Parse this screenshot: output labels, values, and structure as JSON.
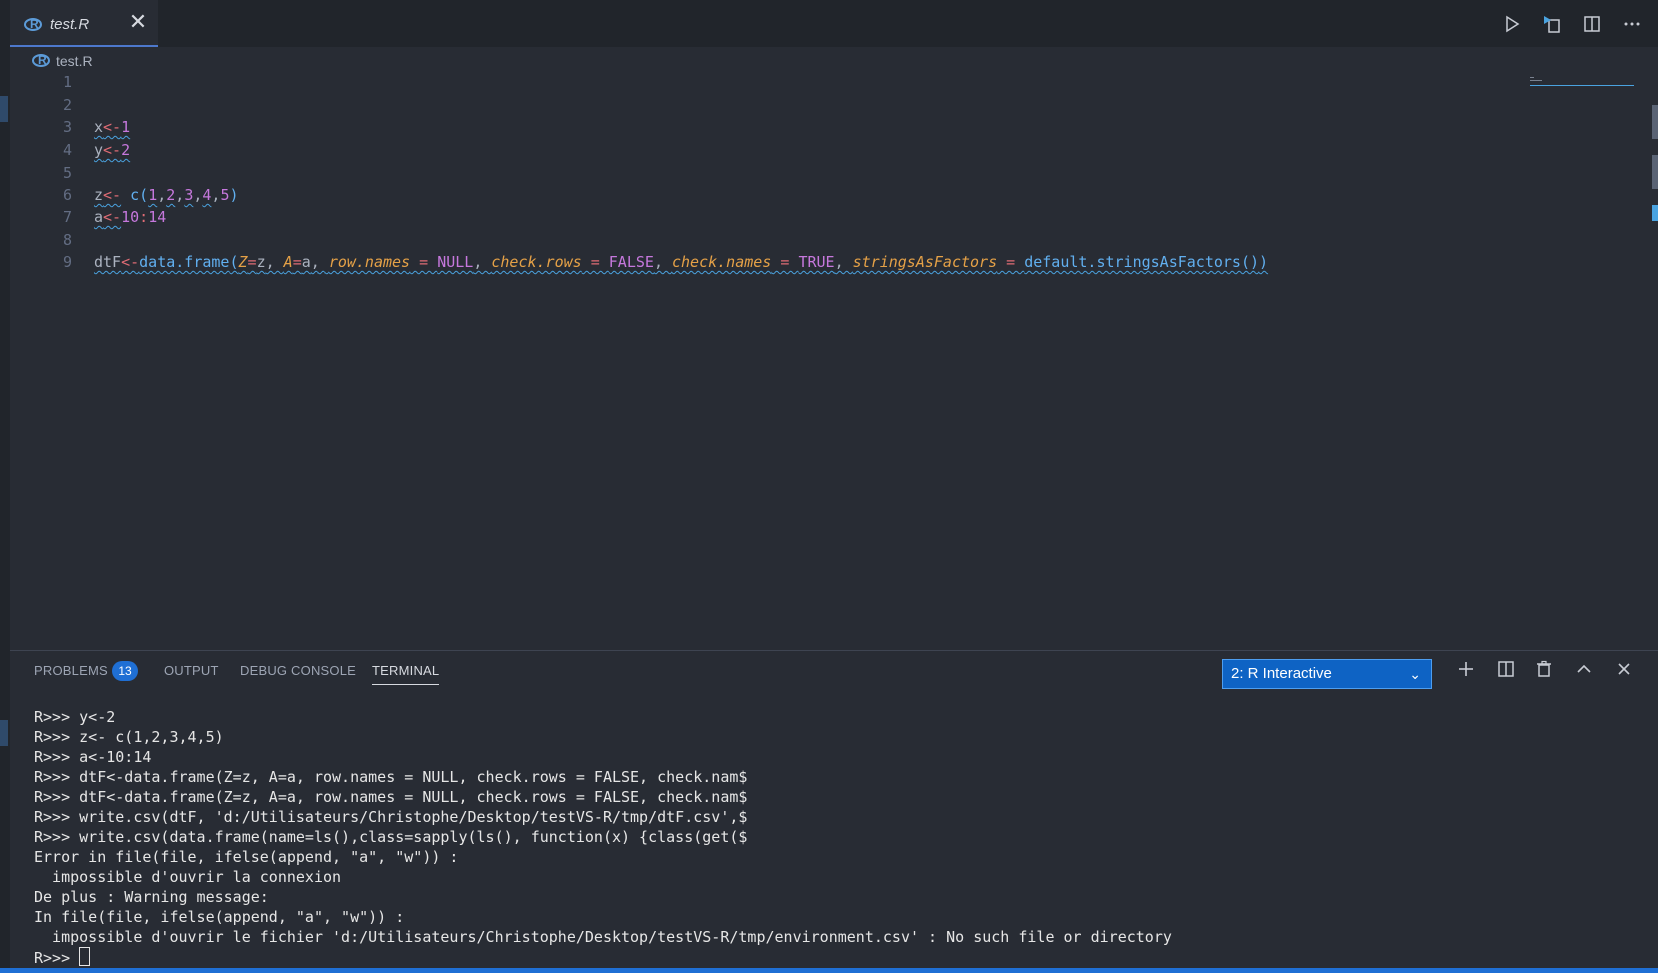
{
  "tab": {
    "title": "test.R",
    "close": "✕"
  },
  "breadcrumb": {
    "file": "test.R"
  },
  "editor": {
    "line_numbers": [
      "1",
      "2",
      "3",
      "4",
      "5",
      "6",
      "7",
      "8",
      "9"
    ],
    "line3": {
      "v": "x",
      "op": "<-",
      "val": "1"
    },
    "line4": {
      "v": "y",
      "op": "<-",
      "val": "2"
    },
    "line6": {
      "v": "z",
      "op": "<-",
      "fn": "c",
      "open": "(",
      "n1": "1",
      "n2": "2",
      "n3": "3",
      "n4": "4",
      "n5": "5",
      "close": ")"
    },
    "line7": {
      "v": "a",
      "op": "<-",
      "from": "10",
      "colon": ":",
      "to": "14"
    },
    "line9": {
      "v": "dtF",
      "op": "<-",
      "fn": "data.frame",
      "open": "(",
      "a1": "Z",
      "eq1": "=",
      "v1": "z",
      "a2": "A",
      "eq2": "=",
      "v2": "a",
      "a3": "row.names",
      "eq3": " = ",
      "v3": "NULL",
      "a4": "check.rows",
      "eq4": " = ",
      "v4": "FALSE",
      "a5": "check.names",
      "eq5": " = ",
      "v5": "TRUE",
      "a6": "stringsAsFactors",
      "eq6": " = ",
      "v6": "default.stringsAsFactors",
      "inner": "()",
      "close": ")"
    }
  },
  "panel": {
    "tabs": [
      {
        "label": "PROBLEMS",
        "badge": "13"
      },
      {
        "label": "OUTPUT"
      },
      {
        "label": "DEBUG CONSOLE"
      },
      {
        "label": "TERMINAL"
      }
    ],
    "terminal_select": "2: R Interactive"
  },
  "terminal": {
    "lines": [
      "R>>> y<-2",
      "R>>> z<- c(1,2,3,4,5)",
      "R>>> a<-10:14",
      "R>>> dtF<-data.frame(Z=z, A=a, row.names = NULL, check.rows = FALSE, check.nam$",
      "R>>> dtF<-data.frame(Z=z, A=a, row.names = NULL, check.rows = FALSE, check.nam$",
      "R>>> write.csv(dtF, 'd:/Utilisateurs/Christophe/Desktop/testVS-R/tmp/dtF.csv',$",
      "R>>> write.csv(data.frame(name=ls(),class=sapply(ls(), function(x) {class(get($",
      "Error in file(file, ifelse(append, \"a\", \"w\")) :",
      "  impossible d'ouvrir la connexion",
      "De plus : Warning message:",
      "In file(file, ifelse(append, \"a\", \"w\")) :",
      "  impossible d'ouvrir le fichier 'd:/Utilisateurs/Christophe/Desktop/testVS-R/tmp/environment.csv' : No such file or directory"
    ],
    "prompt": "R>>> "
  }
}
